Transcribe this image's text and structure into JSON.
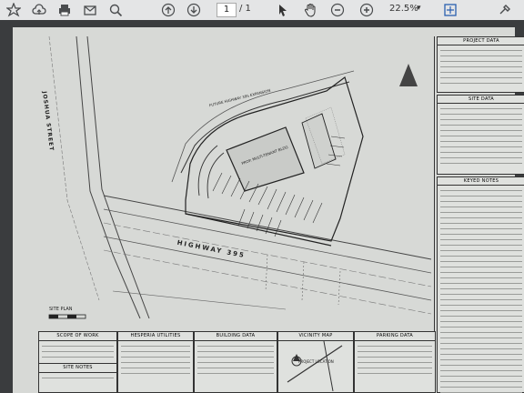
{
  "toolbar": {
    "page_current": "1",
    "page_separator": "/ 1",
    "zoom": "22.5%",
    "zoom_dropdown": "▾",
    "icons": [
      "bookmark-icon",
      "cloud-upload-icon",
      "print-icon",
      "mail-icon",
      "zoom-search-icon",
      "page-up-icon",
      "page-down-icon",
      "cursor-icon",
      "hand-icon",
      "zoom-out-icon",
      "zoom-in-icon",
      "fit-page-icon",
      "tools-icon"
    ]
  },
  "drawing": {
    "street_label": "JOSHUA STREET",
    "highway_label": "HIGHWAY 395",
    "future_label": "FUTURE HIGHWAY 395 EXPANSION",
    "building_label": "PROP. MULTI-TENANT BLDG",
    "site_plan_label": "SITE PLAN"
  },
  "title_block": {
    "project_data": "PROJECT DATA",
    "site_data": "SITE DATA",
    "keyed_notes": "KEYED NOTES"
  },
  "bottom": {
    "scope": "SCOPE OF WORK",
    "utilities": "HESPERIA UTILITIES",
    "building": "BUILDING DATA",
    "vicinity": "VICINITY MAP",
    "parking": "PARKING DATA",
    "site_notes": "SITE NOTES",
    "project_location": "PROJECT LOCATION"
  }
}
